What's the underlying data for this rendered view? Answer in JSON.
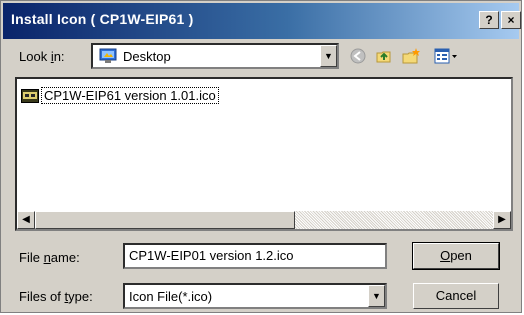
{
  "window": {
    "title": "Install Icon ( CP1W-EIP61 )",
    "help_button": "?",
    "close_button": "×"
  },
  "lookin": {
    "label_pre": "Look ",
    "label_hot": "i",
    "label_post": "n:",
    "value": "Desktop",
    "icon": "desktop-icon"
  },
  "toolbar": {
    "icons": [
      "back-icon",
      "up-folder-icon",
      "new-folder-icon",
      "view-menu-icon"
    ]
  },
  "files": [
    {
      "name": "CP1W-EIP61 version 1.01.ico",
      "icon": "ico-file-icon"
    }
  ],
  "filename": {
    "label_pre": "File ",
    "label_hot": "n",
    "label_post": "ame:",
    "value": "CP1W-EIP01 version 1.2.ico"
  },
  "filetype": {
    "label_pre": "Files of ",
    "label_hot": "t",
    "label_post": "ype:",
    "value": "Icon File(*.ico)"
  },
  "buttons": {
    "open_hot": "O",
    "open_rest": "pen",
    "cancel": "Cancel"
  },
  "colors": {
    "title_start": "#0a246a",
    "title_end": "#a6caf0",
    "face": "#d4d0c8"
  }
}
